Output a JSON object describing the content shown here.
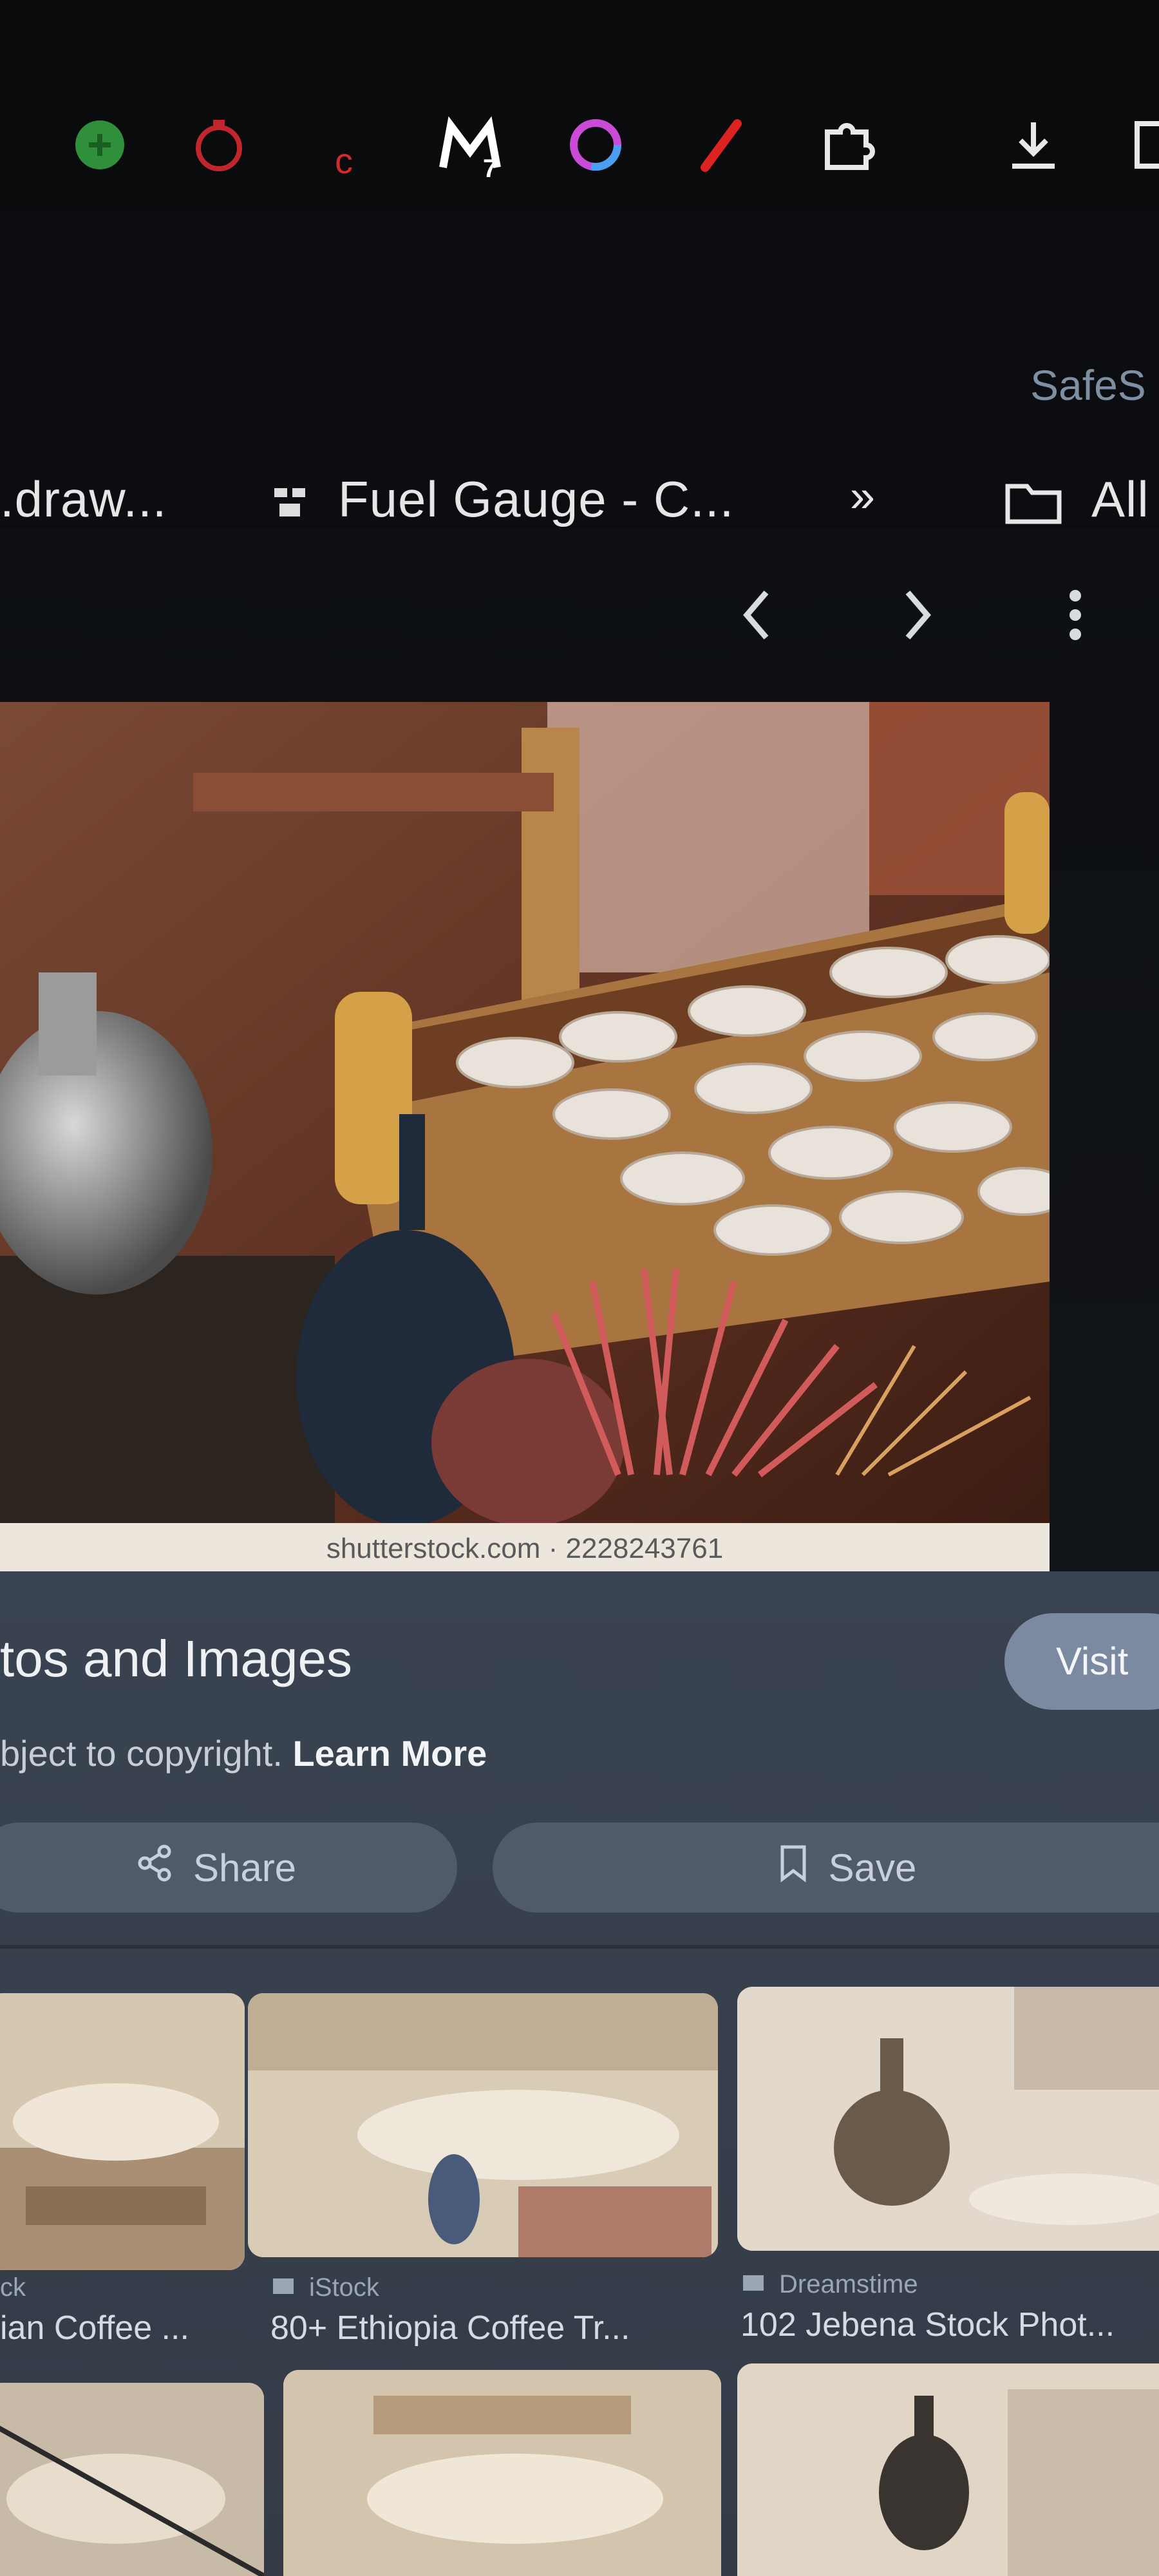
{
  "extensions": {
    "badge_count": "7",
    "letter_ext": "c"
  },
  "bookmarks": {
    "item1": ".draw...",
    "item2": "Fuel Gauge - C...",
    "more": "»",
    "all": "All"
  },
  "safe_search": "SafeS",
  "viewer": {
    "watermark": "shutterstock.com · 2228243761"
  },
  "panel": {
    "title": "tos and Images",
    "visit_label": "Visit",
    "copyright_text": "bject to copyright.",
    "learn_more": "Learn More",
    "share_label": "Share",
    "save_label": "Save"
  },
  "related": [
    {
      "source": "ck",
      "caption": "ian Coffee ..."
    },
    {
      "source": "iStock",
      "caption": "80+ Ethiopia Coffee Tr..."
    },
    {
      "source": "Dreamstime",
      "caption": "102 Jebena Stock Phot..."
    }
  ],
  "colors": {
    "panel_bg": "#3a4351",
    "button_bg": "#4f5a6b",
    "visit_bg": "#7b8aa0",
    "toolbar_bg": "#0a0b0d"
  },
  "icons": [
    "circle-plus-icon",
    "timer-icon",
    "letter-c-icon",
    "m-extension-icon",
    "color-ring-icon",
    "pen-icon",
    "puzzle-icon",
    "download-icon",
    "window-icon",
    "grid-bookmark-icon",
    "folder-icon",
    "chevron-left-icon",
    "chevron-right-icon",
    "more-vertical-icon",
    "share-icon",
    "bookmark-icon"
  ]
}
